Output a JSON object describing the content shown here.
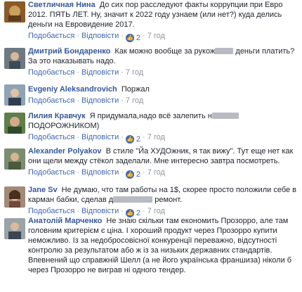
{
  "actions": {
    "like": "Подобається",
    "reply": "Відповісти",
    "sep": "·"
  },
  "comments": [
    {
      "name": "Светличная Нина",
      "text_a": "До сих пор расследуют факты коррупции при Евро 2012. ПЯТЬ ЛЕТ. Ну, значит к 2022 году узнаем (или нет?) куда делись деньги на Евровидение 2017.",
      "text_b": "",
      "likes": "2",
      "time": "7 год"
    },
    {
      "name": "Дмитрий Бондаренко",
      "text_a": "Как можно вообще за рукож",
      "text_b": " деньги платить? За это наказывать надо.",
      "likes": "",
      "time": "7 год"
    },
    {
      "name": "Evgeniy Aleksandrovich",
      "text_a": "Поржал",
      "text_b": "",
      "likes": "",
      "time": "7 год"
    },
    {
      "name": "Лилия Кравчук",
      "text_a": "Я придумала,надо всё залепить н",
      "text_b": " ПОДОРОЖНИКОМ)",
      "likes": "2",
      "time": "7 год"
    },
    {
      "name": "Alexander Polyakov",
      "text_a": "В стиле \"Йа ХУДОжник, я так вижу\". Тут еще нет как они щели между стёкол заделали. Мне интересно завтра посмотреть.",
      "text_b": "",
      "likes": "2",
      "time": "7 год"
    },
    {
      "name": "Jane Sv",
      "text_a": "Не думаю, что там работы на 1$, скорее просто положили себе в карман бабки, сделав д",
      "text_b": " ремонт.",
      "likes": "2",
      "time": "7 год"
    },
    {
      "name": "Анатолій Марченко",
      "text_a": "Не знаю скільки там економить Прозорро, але там головним критерієм є ціна. І хороший продукт через Прозорро купити неможливо. Із за недобросовісної конкуренції переважно, відсутності контролю за результатом або ж із за низьких державних стандартів. Впевнений що справжній Шелл (а не його українська франшиза) ніколи б через Прозорро не виграв ні одного тендер.",
      "text_b": "",
      "likes": "",
      "time": ""
    }
  ]
}
